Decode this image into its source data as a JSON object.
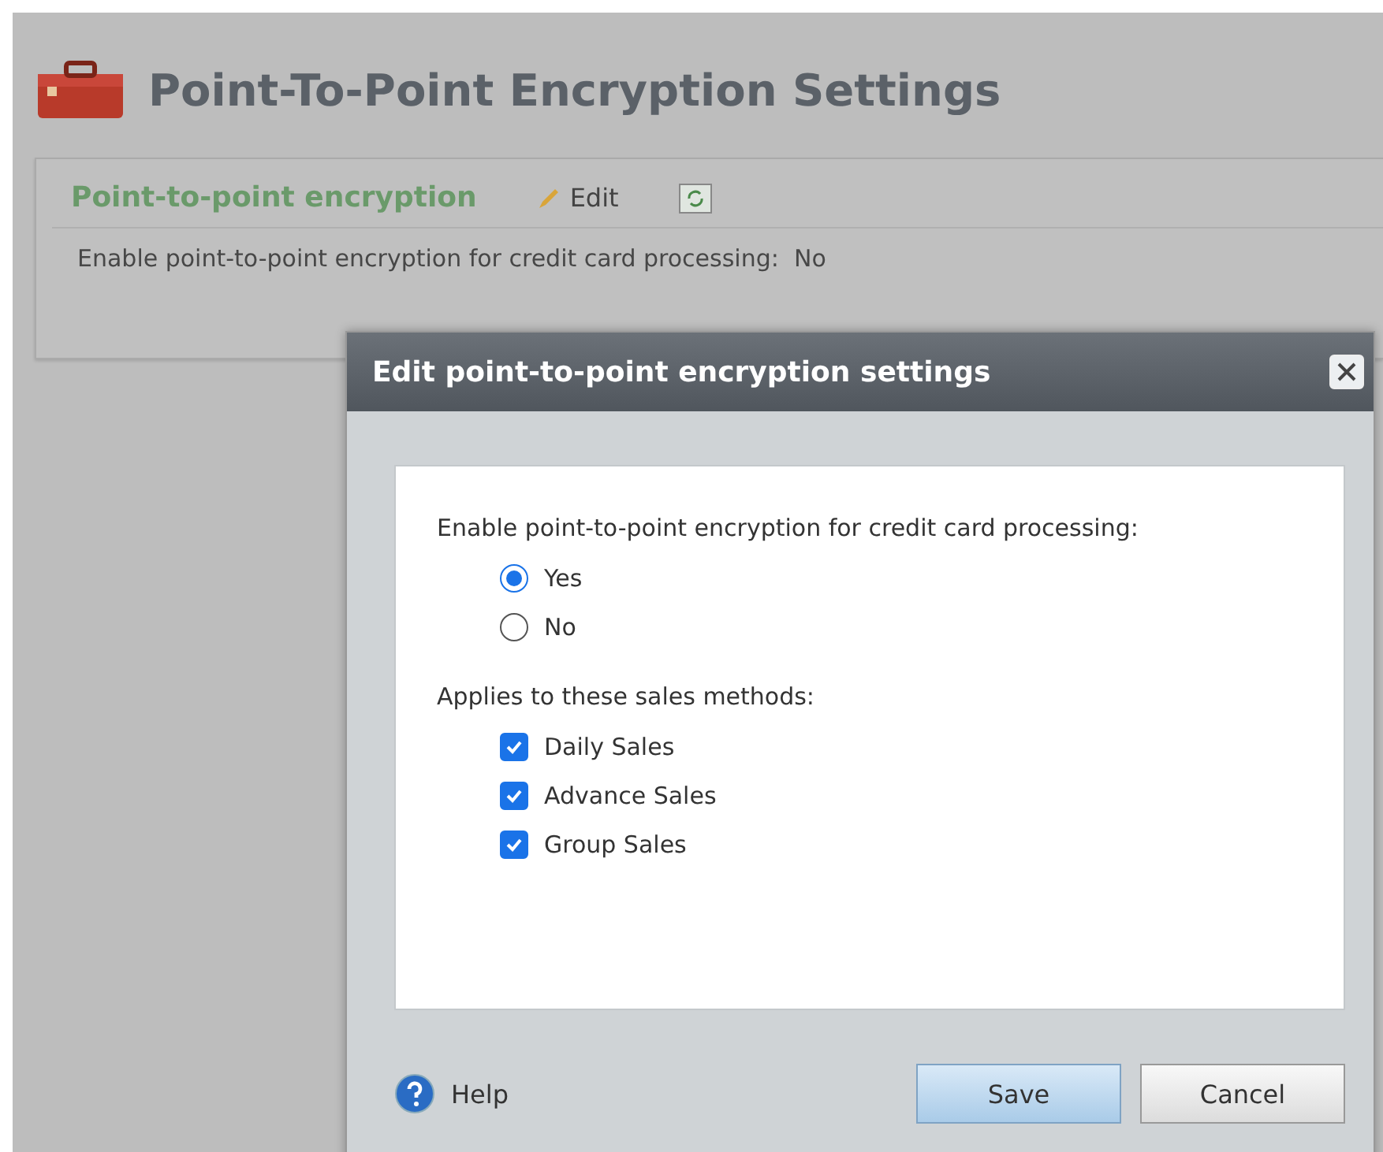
{
  "page": {
    "title": "Point-To-Point Encryption Settings"
  },
  "panel": {
    "heading": "Point-to-point encryption",
    "edit_label": "Edit",
    "setting_label": "Enable point-to-point encryption for credit card processing:",
    "setting_value": "No"
  },
  "dialog": {
    "title": "Edit point-to-point encryption settings",
    "question": "Enable point-to-point encryption for credit card processing:",
    "options": [
      {
        "label": "Yes",
        "selected": true
      },
      {
        "label": "No",
        "selected": false
      }
    ],
    "methods_label": "Applies to these sales methods:",
    "methods": [
      {
        "label": "Daily Sales",
        "checked": true
      },
      {
        "label": "Advance Sales",
        "checked": true
      },
      {
        "label": "Group Sales",
        "checked": true
      }
    ],
    "help": "Help",
    "buttons": [
      {
        "label": "Save",
        "kind": "primary"
      },
      {
        "label": "Cancel",
        "kind": "secondary"
      }
    ]
  }
}
